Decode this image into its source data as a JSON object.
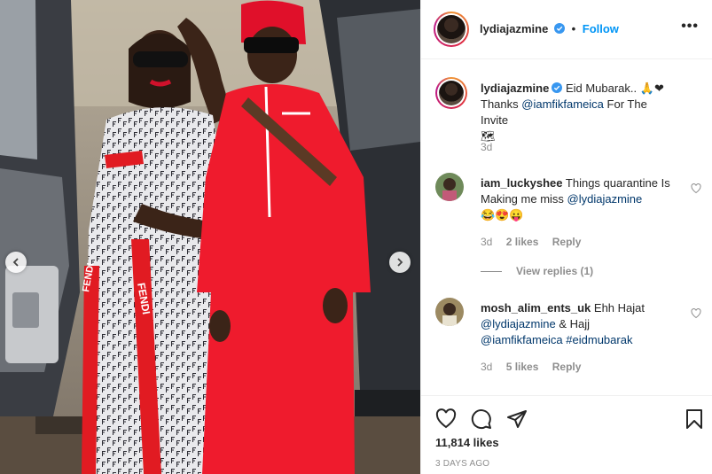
{
  "post": {
    "author": "lydiajazmine",
    "follow_label": "Follow",
    "more_label": "•••",
    "caption": {
      "username": "lydiajazmine",
      "text_line1": "Eid Mubarak..",
      "text_line2_pre": "Thanks ",
      "mention": "@iamfikfameica",
      "text_line2_post": " For The Invite",
      "time": "3d"
    },
    "comments": [
      {
        "username": "iam_luckyshee",
        "text_a": "Things quarantine Is Making me miss ",
        "mention": "@lydiajazmine",
        "time": "3d",
        "likes": "2 likes",
        "reply_label": "Reply",
        "view_replies": "View replies (1)"
      },
      {
        "username": "mosh_alim_ents_uk",
        "text_a": "Ehh Hajat",
        "mention1": "@lydiajazmine",
        "text_b": " & Hajj",
        "mention2": "@iamfikfameica",
        "hashtag": "#eidmubarak",
        "time": "3d",
        "likes": "5 likes",
        "reply_label": "Reply"
      }
    ],
    "likes_count": "11,814 likes",
    "timestamp": "3 DAYS AGO"
  },
  "colors": {
    "accent": "#0095f6",
    "mention": "#00376b",
    "muted": "#8e8e8e",
    "verified": "#3897f0"
  },
  "icons": [
    "chevron-left-icon",
    "chevron-right-icon",
    "verified-icon",
    "heart-icon",
    "comment-icon",
    "share-icon",
    "bookmark-icon"
  ]
}
